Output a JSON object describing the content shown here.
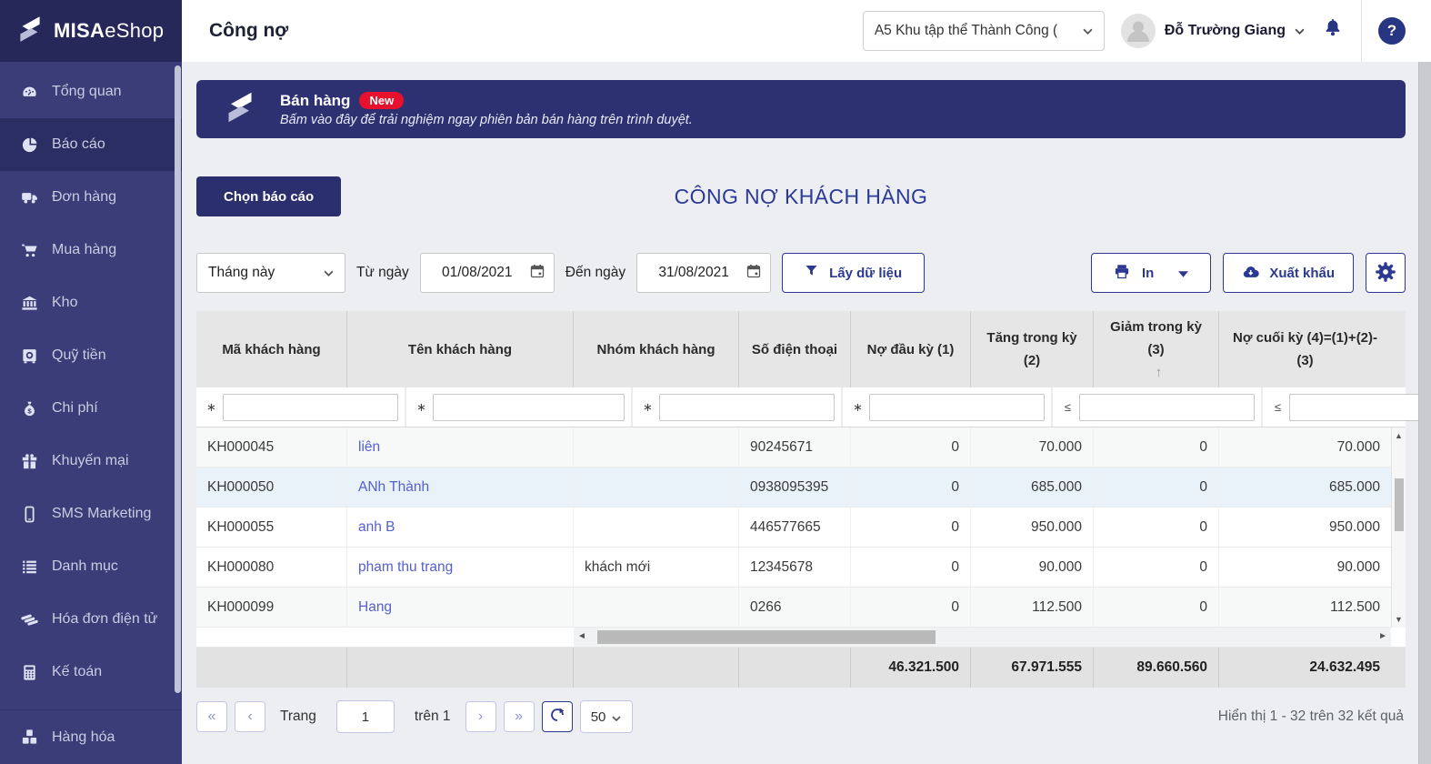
{
  "colors": {
    "accent": "#2b3990",
    "sidebar_bg": "#3a3d77",
    "sidebar_active_bg": "#2b2e63",
    "banner_bg": "#2d3172",
    "badge_new_bg": "#e8112d",
    "link": "#5560cf",
    "table_header_bg": "#e6e6e6",
    "totals_bg": "#e2e2e2"
  },
  "brand": {
    "name_bold": "MISA",
    "name_light": "eShop"
  },
  "topbar": {
    "page_title": "Công nợ",
    "branch_selector_value": "A5 Khu tập thể Thành Công (",
    "user_name": "Đỗ Trường Giang"
  },
  "sidebar": {
    "items": [
      {
        "label": "Tổng quan",
        "icon": "gauge-icon",
        "active": false
      },
      {
        "label": "Báo cáo",
        "icon": "pie-chart-icon",
        "active": true
      },
      {
        "label": "Đơn hàng",
        "icon": "truck-icon",
        "active": false
      },
      {
        "label": "Mua hàng",
        "icon": "cart-icon",
        "active": false
      },
      {
        "label": "Kho",
        "icon": "bank-icon",
        "active": false
      },
      {
        "label": "Quỹ tiền",
        "icon": "safe-icon",
        "active": false
      },
      {
        "label": "Chi phí",
        "icon": "money-bag-icon",
        "active": false
      },
      {
        "label": "Khuyến mại",
        "icon": "gift-icon",
        "active": false
      },
      {
        "label": "SMS Marketing",
        "icon": "phone-icon",
        "active": false
      },
      {
        "label": "Danh mục",
        "icon": "list-icon",
        "active": false
      },
      {
        "label": "Hóa đơn điện tử",
        "icon": "layers-icon",
        "active": false
      },
      {
        "label": "Kế toán",
        "icon": "calculator-icon",
        "active": false
      },
      {
        "label": "Hàng hóa",
        "icon": "cubes-icon",
        "active": false
      }
    ]
  },
  "banner": {
    "title": "Bán hàng",
    "badge": "New",
    "subtitle": "Bấm vào đây để trải nghiệm ngay phiên bản bán hàng trên trình duyệt."
  },
  "report": {
    "choose_button": "Chọn báo cáo",
    "title": "CÔNG NỢ KHÁCH HÀNG"
  },
  "filters": {
    "period": "Tháng này",
    "from_label": "Từ ngày",
    "from_date": "01/08/2021",
    "to_label": "Đến ngày",
    "to_date": "31/08/2021",
    "get_data_button": "Lấy dữ liệu",
    "print_button": "In",
    "export_button": "Xuất khẩu"
  },
  "table": {
    "columns": [
      {
        "label": "Mã khách hàng",
        "filter_op": "∗"
      },
      {
        "label": "Tên khách hàng",
        "filter_op": "∗"
      },
      {
        "label": "Nhóm khách hàng",
        "filter_op": "∗"
      },
      {
        "label": "Số điện thoại",
        "filter_op": "∗"
      },
      {
        "label": "Nợ đầu kỳ (1)",
        "filter_op": "≤"
      },
      {
        "label": "Tăng trong kỳ (2)",
        "filter_op": "≤"
      },
      {
        "label": "Giảm trong kỳ (3)",
        "filter_op": "≤",
        "sorted": "asc"
      },
      {
        "label": "Nợ cuối kỳ (4)=(1)+(2)-(3)",
        "filter_op": "≤"
      }
    ],
    "rows": [
      {
        "code": "KH000045",
        "name": "liên",
        "group": "",
        "phone": "90245671",
        "opening": "0",
        "increase": "70.000",
        "decrease": "0",
        "closing": "70.000",
        "highlighted": false
      },
      {
        "code": "KH000050",
        "name": "ANh Thành",
        "group": "",
        "phone": "0938095395",
        "opening": "0",
        "increase": "685.000",
        "decrease": "0",
        "closing": "685.000",
        "highlighted": true
      },
      {
        "code": "KH000055",
        "name": "anh B",
        "group": "",
        "phone": "446577665",
        "opening": "0",
        "increase": "950.000",
        "decrease": "0",
        "closing": "950.000",
        "highlighted": false
      },
      {
        "code": "KH000080",
        "name": "pham thu trang",
        "group": "khách mới",
        "phone": "12345678",
        "opening": "0",
        "increase": "90.000",
        "decrease": "0",
        "closing": "90.000",
        "highlighted": false
      },
      {
        "code": "KH000099",
        "name": "Hang",
        "group": "",
        "phone": "0266",
        "opening": "0",
        "increase": "112.500",
        "decrease": "0",
        "closing": "112.500",
        "highlighted": false
      }
    ],
    "totals": {
      "opening": "46.321.500",
      "increase": "67.971.555",
      "decrease": "89.660.560",
      "closing": "24.632.495"
    }
  },
  "pagination": {
    "page_label": "Trang",
    "page_value": "1",
    "of_label": "trên 1",
    "page_size": "50",
    "summary": "Hiển thị 1 - 32 trên 32 kết quả"
  },
  "icons": {
    "sort_ascending": "↑",
    "first_page": "«",
    "prev_page": "‹",
    "next_page": "›",
    "last_page": "»",
    "scroll_up": "▲",
    "scroll_down": "▼",
    "scroll_left": "◄",
    "scroll_right": "►",
    "help": "?"
  }
}
